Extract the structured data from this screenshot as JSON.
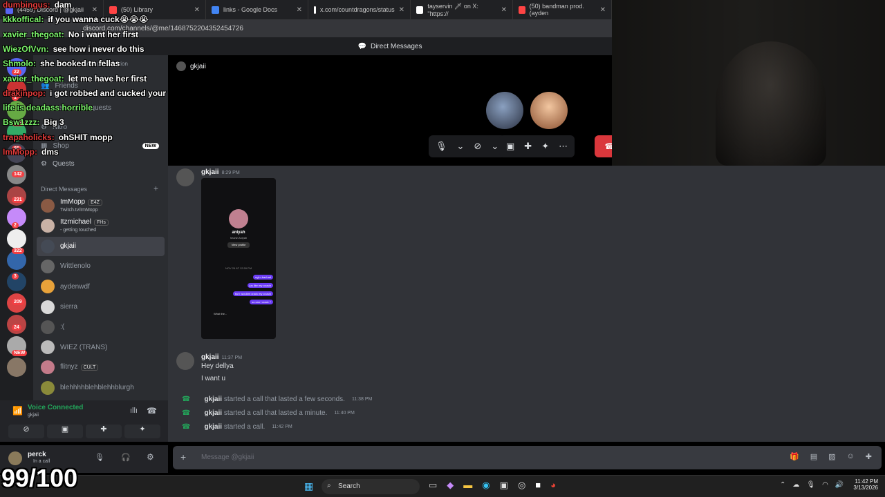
{
  "browser": {
    "tabs": [
      {
        "label": "(4459) Discord | @gkjaii",
        "color": "#5865f2"
      },
      {
        "label": "(50) Library",
        "color": "#ff4444"
      },
      {
        "label": "links - Google Docs",
        "color": "#4285f4"
      },
      {
        "label": "x.com/countdragons/status",
        "color": "#ffffff"
      },
      {
        "label": "tayservin 🗡 on X: \"https://",
        "color": "#ffffff"
      },
      {
        "label": "(50) bandman prod. (ayden",
        "color": "#ff4444"
      }
    ],
    "url": "discord.com/channels/@me/1468752204352454726"
  },
  "header": {
    "title": "Direct Messages"
  },
  "call": {
    "user": "gkjaii"
  },
  "sidebar": {
    "search_placeholder": "Find or start a conversation",
    "items": [
      "Friends",
      "Message Requests",
      "Nitro",
      "Shop",
      "Quests"
    ],
    "shop_badge": "NEW",
    "dm_header": "Direct Messages",
    "dms": [
      {
        "name": "ImMopp",
        "tag": "E4Z",
        "sub": "Twitch.tv/ImMopp",
        "color": "#8a5a44"
      },
      {
        "name": "Itzmichael",
        "tag": "FHs",
        "sub": "- getting touched",
        "color": "#c9b2a6"
      },
      {
        "name": "gkjaii",
        "tag": "",
        "sub": "",
        "color": "#444a55"
      },
      {
        "name": "Wittlenolo",
        "tag": "",
        "sub": "",
        "color": "#666"
      },
      {
        "name": "aydenwdf",
        "tag": "",
        "sub": "",
        "color": "#e8a23a"
      },
      {
        "name": "sierra",
        "tag": "",
        "sub": "",
        "color": "#d9d9d9"
      },
      {
        "name": ":(",
        "tag": "",
        "sub": "",
        "color": "#555"
      },
      {
        "name": "WIEZ (TRANS)",
        "tag": "",
        "sub": "",
        "color": "#bbb"
      },
      {
        "name": "flitnyz",
        "tag": "CULT",
        "sub": "",
        "color": "#c47b8a"
      },
      {
        "name": "blehhhhblehblehhblurgh",
        "tag": "",
        "sub": "",
        "color": "#8a8a3a"
      }
    ],
    "server_badges": [
      "22",
      "1",
      "198",
      "65",
      "142",
      "231",
      "2",
      "322",
      "3",
      "209",
      "24",
      "NEW"
    ]
  },
  "voice": {
    "status": "Voice Connected",
    "channel": "gkjaii"
  },
  "user": {
    "name": "perck",
    "status": "In a call"
  },
  "messages": [
    {
      "user": "gkjaii",
      "time": "8:29 PM",
      "lines": []
    },
    {
      "user": "gkjaii",
      "time": "11:37 PM",
      "lines": [
        "Hey dellya",
        "I want u"
      ]
    }
  ],
  "image_preview": {
    "name": "aniyah",
    "handle": "heartz.Aniyah",
    "button": "View profile",
    "date": "NOV 26 AT 12:59 PM",
    "bubbles": [
      "ngl u bad asf",
      "jus like my cousin",
      "but i wouldnt crack my cousin",
      "so can i crack ?"
    ],
    "footer": "What the..."
  },
  "system": [
    {
      "user": "gkjaii",
      "text": "started a call that lasted a few seconds.",
      "time": "11:38 PM"
    },
    {
      "user": "gkjaii",
      "text": "started a call that lasted a minute.",
      "time": "11:40 PM"
    },
    {
      "user": "gkjaii",
      "text": "started a call.",
      "time": "11:42 PM"
    }
  ],
  "input": {
    "placeholder": "Message @gkjaii"
  },
  "taskbar": {
    "search": "Search",
    "time": "11:42 PM",
    "date": "3/13/2026"
  },
  "overlay_chat": [
    {
      "name": "dumbingus",
      "color": "#e43b3b",
      "text": "dam"
    },
    {
      "name": "kkkoffical",
      "color": "#7cf46b",
      "text": "if you wanna cuck😭😭😭"
    },
    {
      "name": "xavier_thegoat",
      "color": "#7cf46b",
      "text": "No i want her first"
    },
    {
      "name": "WiezOfVvn",
      "color": "#7cf46b",
      "text": "see how i never do this"
    },
    {
      "name": "Shmolo",
      "color": "#7cf46b",
      "text": "she booked tn fellas"
    },
    {
      "name": "xavier_thegoat",
      "color": "#7cf46b",
      "text": "let me have her first"
    },
    {
      "name": "drakinpop",
      "color": "#e43b3b",
      "text": "i got robbed and cucked your"
    },
    {
      "name": "",
      "color": "#7cf46b",
      "text": "life is deadass horrible"
    },
    {
      "name": "Bsw1zzz",
      "color": "#7cf46b",
      "text": "Big 3"
    },
    {
      "name": "trapaholicks",
      "color": "#e43b3b",
      "text": "ohSHIT mopp"
    },
    {
      "name": "ImMopp",
      "color": "#e43b3b",
      "text": "dms"
    }
  ],
  "score": "99/100"
}
